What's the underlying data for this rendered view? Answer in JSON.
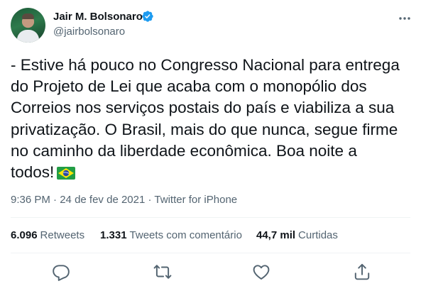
{
  "author": {
    "name": "Jair M. Bolsonaro",
    "handle": "@jairbolsonaro"
  },
  "tweet": {
    "text": "- Estive há pouco no Congresso Nacional para entrega\ndo Projeto de Lei que acaba com o monopólio dos\nCorreios nos serviços postais do país e viabiliza a sua\nprivatização. O Brasil, mais do que nunca, segue firme\nno caminho da liberdade econômica. Boa noite a\ntodos!",
    "time": "9:36 PM",
    "separator": "·",
    "date": "24 de fev de 2021",
    "source": "Twitter for iPhone"
  },
  "stats": {
    "retweets_count": "6.096",
    "retweets_label": "Retweets",
    "quotes_count": "1.331",
    "quotes_label": "Tweets com comentário",
    "likes_count": "44,7 mil",
    "likes_label": "Curtidas"
  },
  "icons": {
    "verified": "verified-badge-icon",
    "more": "more-options-icon",
    "flag": "brazil-flag-emoji",
    "reply": "reply-icon",
    "retweet": "retweet-icon",
    "like": "like-icon",
    "share": "share-icon"
  },
  "colors": {
    "verified_blue": "#1d9bf0",
    "secondary_text": "#536471",
    "primary_text": "#0f1419",
    "divider": "#eff3f4"
  }
}
